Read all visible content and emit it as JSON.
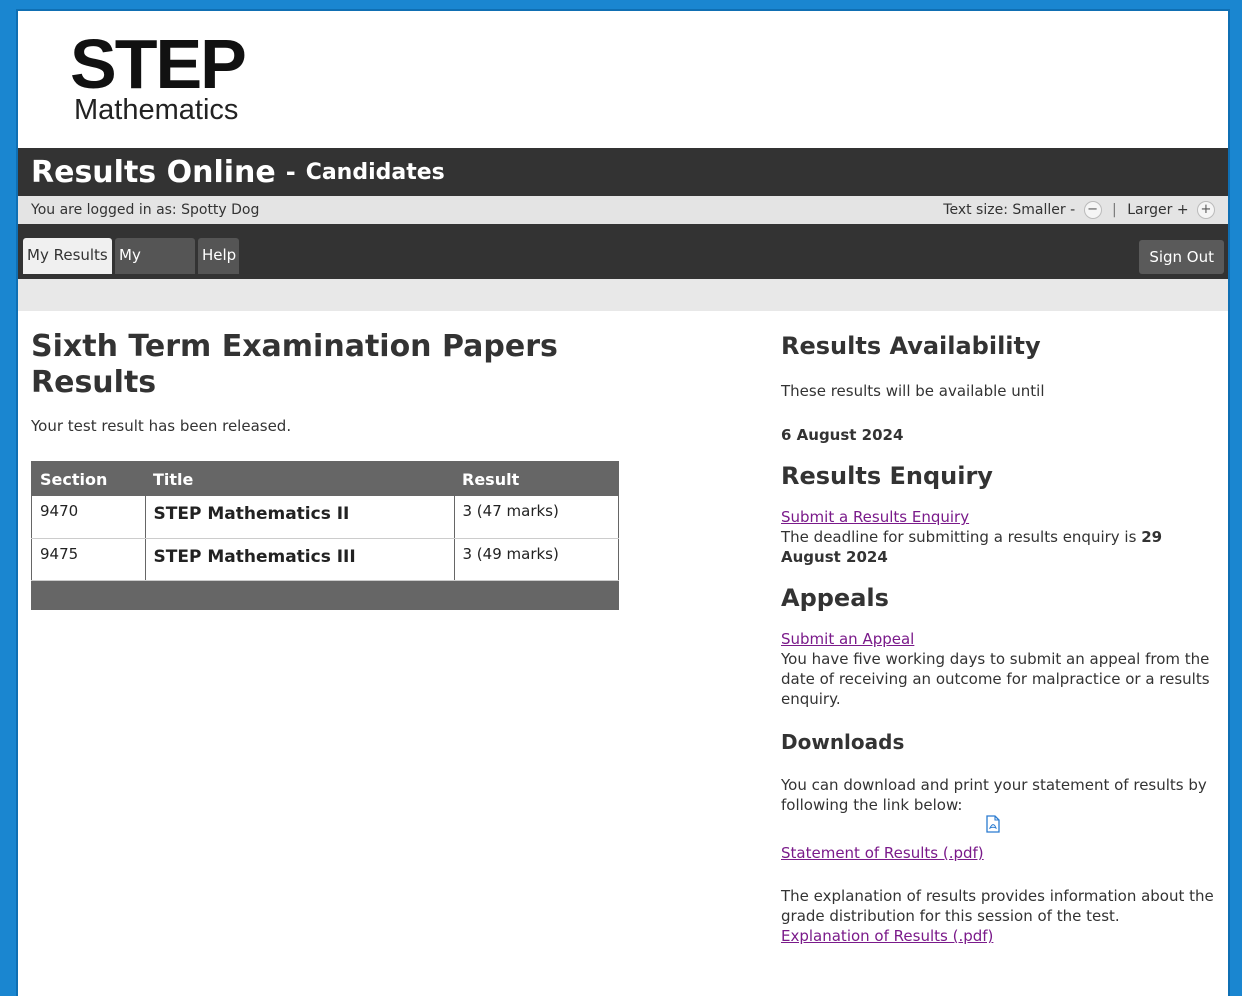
{
  "logo": {
    "line1": "STEP",
    "line2": "Mathematics"
  },
  "header": {
    "title": "Results Online",
    "separator": "-",
    "subtitle": "Candidates"
  },
  "userbar": {
    "logged_in_label": "You are logged in as: Spotty Dog",
    "text_size_label": "Text size: Smaller -",
    "smaller_icon": "−",
    "divider": "|",
    "larger_label": "Larger +",
    "larger_icon": "+"
  },
  "nav": {
    "tabs": [
      {
        "label": "My Results",
        "active": true
      },
      {
        "label": "My Profile",
        "active": false
      },
      {
        "label": "Help",
        "active": false
      }
    ],
    "sign_out": "Sign Out"
  },
  "main": {
    "heading": "Sixth Term Examination Papers Results",
    "status": "Your test result has been released.",
    "table": {
      "headers": [
        "Section",
        "Title",
        "Result"
      ],
      "rows": [
        {
          "section": "9470",
          "title": "STEP Mathematics II",
          "result": "3 (47 marks)"
        },
        {
          "section": "9475",
          "title": "STEP Mathematics III",
          "result": "3 (49 marks)"
        }
      ]
    }
  },
  "sidebar": {
    "availability": {
      "heading": "Results Availability",
      "text": "These results will be available until",
      "date": "6 August 2024"
    },
    "enquiry": {
      "heading": "Results Enquiry",
      "link": "Submit a Results Enquiry",
      "text": "The deadline for submitting a results enquiry is",
      "deadline": "29 August 2024"
    },
    "appeals": {
      "heading": "Appeals",
      "link": "Submit an Appeal",
      "text": "You have five working days to submit an appeal from the date of receiving an outcome for malpractice or a results enquiry."
    },
    "downloads": {
      "heading": "Downloads",
      "text": "You can download and print your statement of results by following the link below:",
      "icon": "pdf-document-icon",
      "statement_link": "Statement of Results (.pdf)",
      "explanation_text": "The explanation of results provides information about the grade distribution for this session of the test.",
      "explanation_link": "Explanation of Results (.pdf)"
    }
  },
  "colors": {
    "frame": "#1a86d0",
    "bar": "#333333",
    "link": "#7a1a8a",
    "table_header": "#666666"
  }
}
